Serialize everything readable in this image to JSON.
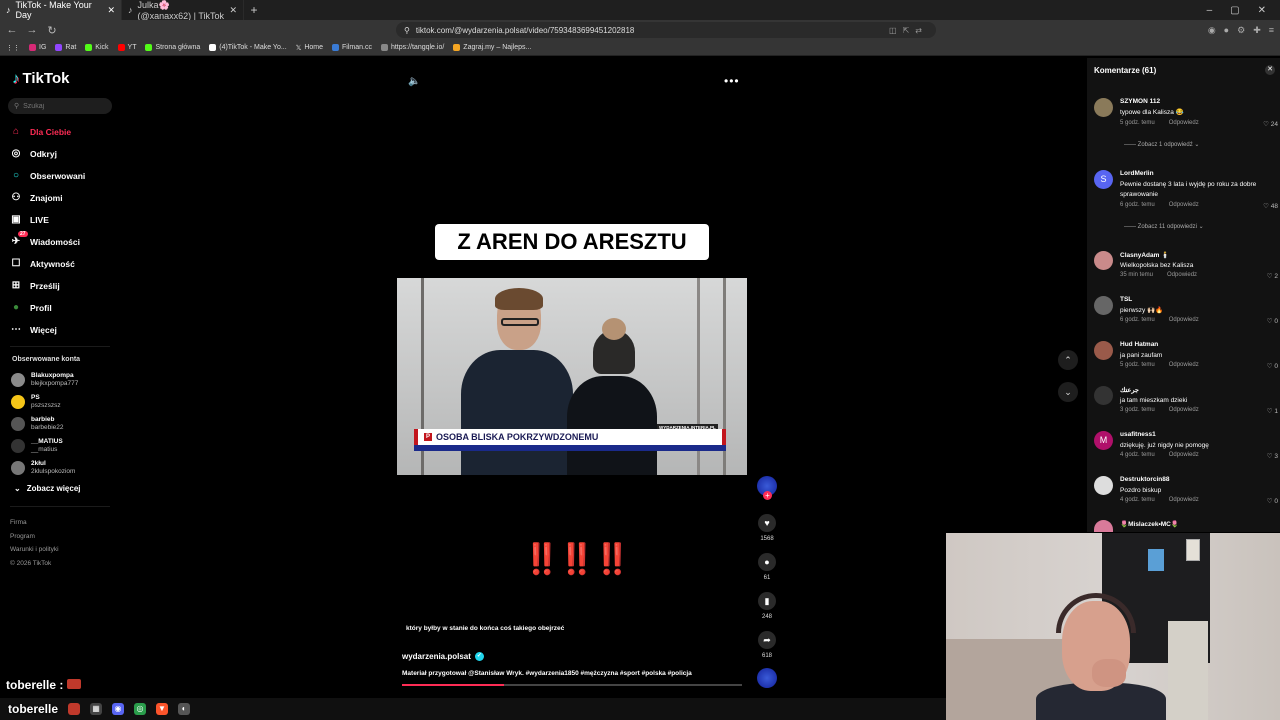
{
  "browser": {
    "tabs": [
      {
        "title": "TikTok - Make Your Day",
        "active": true
      },
      {
        "title": "Julka🌸 (@xanaxx62) | TikTok",
        "active": false
      }
    ],
    "url": "tiktok.com/@wydarzenia.polsat/video/7593483699451202818",
    "bookmarks": [
      "IG",
      "Rat",
      "Kick",
      "YT",
      "Strona główna",
      "(4)TikTok - Make Yo...",
      "Home",
      "Filman.cc",
      "https://tangqle.io/",
      "Zagraj.my – Najleps..."
    ]
  },
  "sidebar": {
    "logo": "TikTok",
    "search_placeholder": "Szukaj",
    "nav": [
      {
        "label": "Dla Ciebie",
        "icon": "home-icon",
        "active": true
      },
      {
        "label": "Odkryj",
        "icon": "compass-icon"
      },
      {
        "label": "Obserwowani",
        "icon": "following-icon"
      },
      {
        "label": "Znajomi",
        "icon": "friends-icon"
      },
      {
        "label": "LIVE",
        "icon": "live-icon"
      },
      {
        "label": "Wiadomości",
        "icon": "messages-icon",
        "badge": "27"
      },
      {
        "label": "Aktywność",
        "icon": "activity-icon"
      },
      {
        "label": "Prześlij",
        "icon": "upload-icon"
      },
      {
        "label": "Profil",
        "icon": "profile-icon"
      },
      {
        "label": "Więcej",
        "icon": "more-icon"
      }
    ],
    "followed_title": "Obserwowane konta",
    "accounts": [
      {
        "name": "Blakuxpompa",
        "handle": "blejkxpompa777"
      },
      {
        "name": "PS",
        "handle": "pszszszsz"
      },
      {
        "name": "barbieb",
        "handle": "barbebie22"
      },
      {
        "name": "__MATIUS",
        "handle": "__matius"
      },
      {
        "name": "2kłul",
        "handle": "2klulspokoziom"
      }
    ],
    "see_more": "Zobacz więcej",
    "footer": [
      "Firma",
      "Program",
      "Warunki i polityki",
      "© 2026 TikTok"
    ]
  },
  "video": {
    "title_overlay": "Z AREN DO ARESZTU",
    "lower_third": "OSOBA BLISKA POKRZYWDZONEMU",
    "source_watermark": "WYDARZENIA.INTERIA.PL",
    "exclamations": "‼️‼️‼️",
    "caption_overlay": "który byłby w stanie do końca coś takiego obejrzeć",
    "author": "wydarzenia.polsat",
    "description": "Materiał przygotował @Stanisław Wryk. #wydarzenia1850 #mężczyzna #sport #polska #policja",
    "progress": 0.3,
    "likes": "1568",
    "comments": "61",
    "saves": "248",
    "shares": "618"
  },
  "comments_panel": {
    "title": "Komentarze (61)",
    "reply_label": "Odpowiedz",
    "items": [
      {
        "user": "SZYMON 112",
        "text": "typowe dla Kalisza 😂",
        "time": "5 godz. temu",
        "likes": "24",
        "replies": "Zobacz 1 odpowiedź"
      },
      {
        "user": "LordMerlin",
        "text": "Pewnie dostanę 3 lata i wyjdę po roku za dobre sprawowanie",
        "time": "6 godz. temu",
        "likes": "48",
        "replies": "Zobacz 11 odpowiedzi"
      },
      {
        "user": "ClasnyAdam 🕯️",
        "text": "Wielkopolska bez Kalisza",
        "time": "35 min temu",
        "likes": "2"
      },
      {
        "user": "TSL",
        "text": "pierwszy 🙌🏻🔥",
        "time": "6 godz. temu",
        "likes": "0"
      },
      {
        "user": "Hud Hatman",
        "text": "ja pani zaufam",
        "time": "5 godz. temu",
        "likes": "0"
      },
      {
        "user": "جرعتك",
        "text": "ja tam mieszkam dzieki",
        "time": "3 godz. temu",
        "likes": "1"
      },
      {
        "user": "usafitness1",
        "text": "dziękuję. już nigdy nie pomogę",
        "time": "4 godz. temu",
        "likes": "3"
      },
      {
        "user": "Destruktorcin88",
        "text": "Pozdro biskup",
        "time": "4 godz. temu",
        "likes": "0"
      },
      {
        "user": "🌷Mislaczek•MC🌷",
        "text": "",
        "time": "",
        "likes": ""
      }
    ]
  },
  "stream_overlay": {
    "name": "toberelle",
    "name2": "toberelle"
  }
}
